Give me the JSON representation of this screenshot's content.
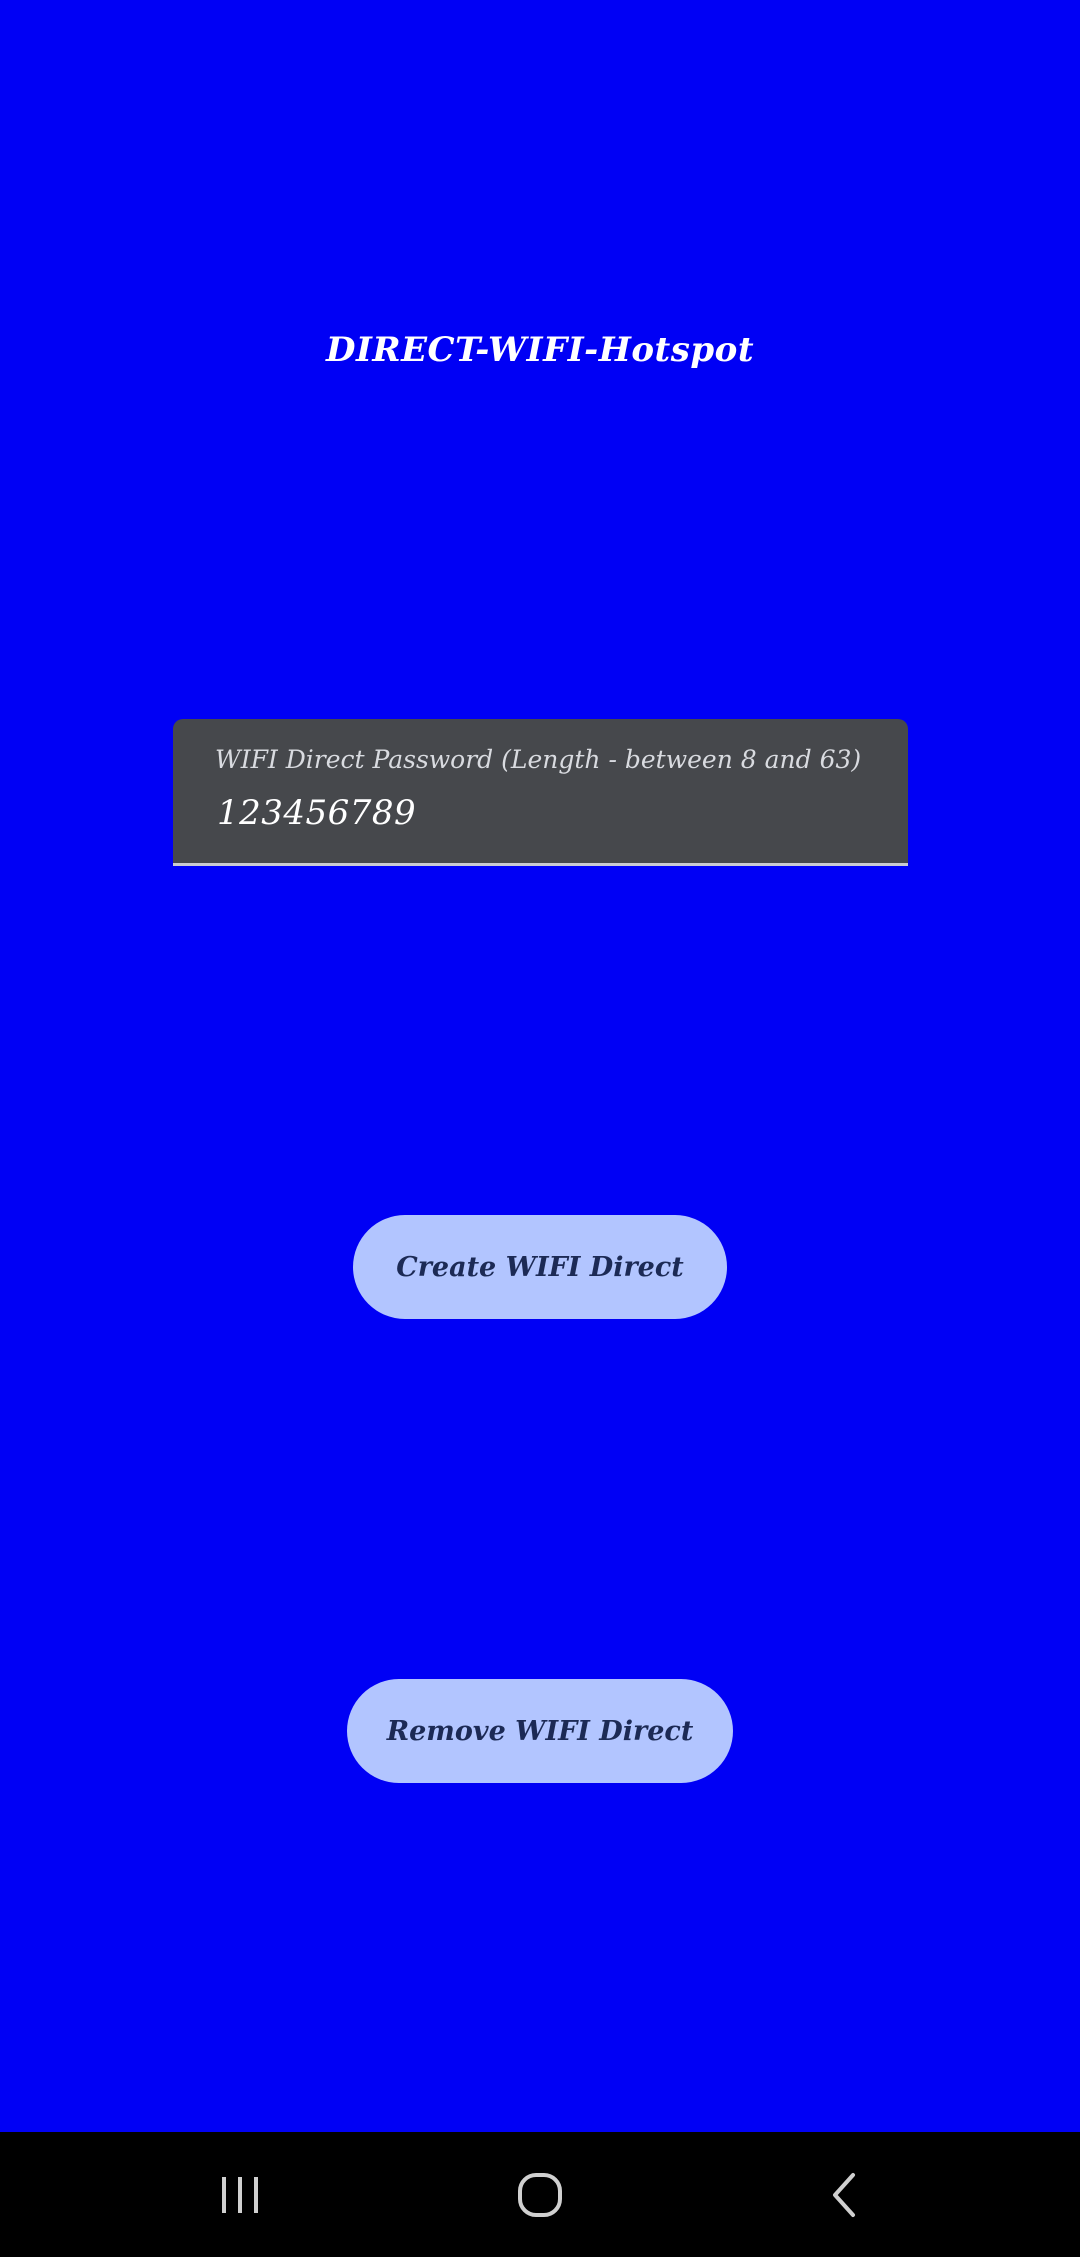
{
  "app": {
    "title": "DIRECT-WIFI-Hotspot"
  },
  "password_field": {
    "label": "WIFI Direct Password (Length - between 8 and 63)",
    "value": "123456789"
  },
  "buttons": {
    "create_label": "Create WIFI Direct",
    "remove_label": "Remove WIFI Direct"
  },
  "navbar": {
    "recents_icon": "recents-icon",
    "home_icon": "home-icon",
    "back_icon": "back-icon"
  },
  "colors": {
    "background": "#0000f5",
    "field_background": "#46484c",
    "button_background": "#b2c5ff",
    "button_text": "#1c2a55",
    "navbar": "#000000"
  }
}
